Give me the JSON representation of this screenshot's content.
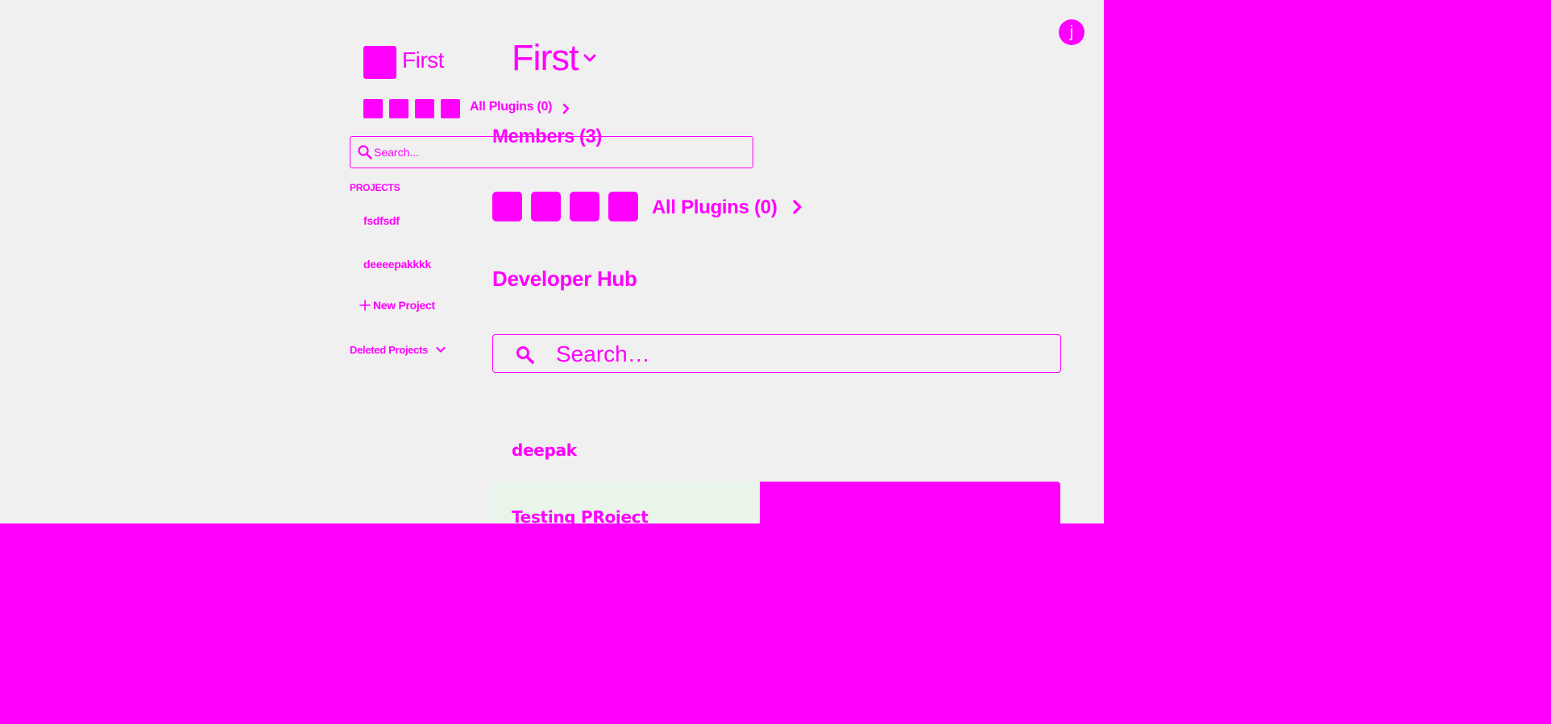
{
  "sidebar": {
    "workspace_name": "First",
    "plugins_label": "All Plugins (0)",
    "search_placeholder": "Search...",
    "projects_heading": "PROJECTS",
    "projects": [
      "fsdfsdf",
      "deeeepakkkk"
    ],
    "new_project_label": "New Project",
    "deleted_projects_label": "Deleted Projects"
  },
  "main": {
    "project_title": "First",
    "members_heading": "Members (3)",
    "plugins_label": "All Plugins (0)",
    "developer_hub_heading": "Developer Hub",
    "search_placeholder": "Search…",
    "cards": [
      "deepak",
      "Testing PRoject"
    ]
  },
  "user": {
    "avatar_initial": "j"
  },
  "colors": {
    "accent": "#ff00ff",
    "background": "#f0f0f0",
    "card_highlight": "#eaf5ea"
  },
  "icons": [
    "search-icon",
    "chevron-right-icon",
    "chevron-down-icon",
    "plus-icon"
  ]
}
